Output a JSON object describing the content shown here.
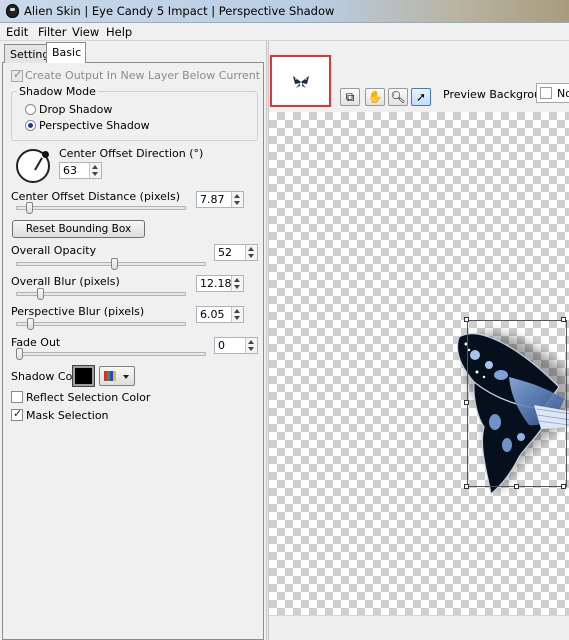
{
  "window": {
    "title": "Alien Skin | Eye Candy 5 Impact | Perspective Shadow"
  },
  "menu": [
    "Edit",
    "Filter",
    "View",
    "Help"
  ],
  "tabs": {
    "settings": "Settings",
    "basic": "Basic"
  },
  "basic": {
    "create_output_label": "Create Output In New Layer Below Current",
    "create_output_checked": true,
    "shadow_mode": {
      "title": "Shadow Mode",
      "options": [
        "Drop Shadow",
        "Perspective Shadow"
      ],
      "selected": "Perspective Shadow"
    },
    "center_offset_direction": {
      "label": "Center Offset Direction (°)",
      "value": "63"
    },
    "center_offset_distance": {
      "label": "Center Offset Distance (pixels)",
      "value": "7.87",
      "level": 0.06
    },
    "reset_bounding_box": "Reset Bounding Box",
    "overall_opacity": {
      "label": "Overall Opacity",
      "value": "52",
      "level": 0.52
    },
    "overall_blur": {
      "label": "Overall Blur (pixels)",
      "value": "12.18",
      "level": 0.13
    },
    "perspective_blur": {
      "label": "Perspective Blur (pixels)",
      "value": "6.05",
      "level": 0.07
    },
    "fade_out": {
      "label": "Fade Out",
      "value": "0",
      "level": 0.0
    },
    "shadow_color": {
      "label": "Shadow Color",
      "color": "#000000"
    },
    "reflect_selection_color": {
      "label": "Reflect Selection Color",
      "checked": false
    },
    "mask_selection": {
      "label": "Mask Selection",
      "checked": true
    }
  },
  "preview": {
    "background_label": "Preview Background:",
    "background_value": "No",
    "tools": [
      "preview-compare-icon",
      "hand-pan-icon",
      "zoom-magnifier-icon",
      "arrow-select-icon"
    ]
  },
  "colors": {
    "navigator_border": "#e03535",
    "accent": "#3d7bc4"
  }
}
